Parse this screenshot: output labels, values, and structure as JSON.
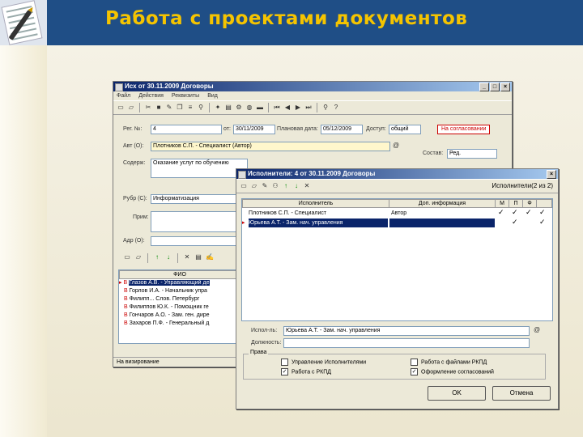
{
  "slide": {
    "title": "Работа с проектами документов"
  },
  "main_window": {
    "title": "Исх от 30.11.2009 Договоры",
    "menu": [
      "Файл",
      "Действия",
      "Реквизиты",
      "Вид"
    ],
    "reg_label": "Рег. №:",
    "reg_value": "4",
    "from_label": "от:",
    "from_value": "30/11/2009",
    "planned_label": "Плановая дата:",
    "planned_value": "05/12/2009",
    "access_label": "Доступ:",
    "access_value": "общий",
    "status_badge": "На согласовании",
    "author_label": "Авт (О):",
    "author_value": "Плотников С.П. - Специалист (Автор)",
    "content_label": "Содерж:",
    "content_value": "Оказание услуг по обучению",
    "state_label": "Состав:",
    "state_value": "Ред.",
    "rubric_label": "Рубр (С):",
    "rubric_value": "Информатизация",
    "note_label": "Прим:",
    "addr_label": "Адр (О):",
    "list_header": "ФИО",
    "list_rows": [
      {
        "mark": "В",
        "text": "Глазов А.В. - Управляющий де"
      },
      {
        "mark": "В",
        "text": "Горлов И.А. - Начальник упра"
      },
      {
        "mark": "В",
        "text": "Филипп... Слов. Петербург"
      },
      {
        "mark": "В",
        "text": "Филиппов Ю.К. - Помощник ге"
      },
      {
        "mark": "В",
        "text": "Гончаров А.О. - Зам. ген. дире"
      },
      {
        "mark": "В",
        "text": "Захаров П.Ф. - Генеральный д"
      }
    ],
    "statusbar": "На визирование"
  },
  "exec_window": {
    "title": "Исполнители: 4 от 30.11.2009 Договоры",
    "counter": "Исполнители(2 из 2)",
    "col_exec": "Исполнитель",
    "col_extra": "Доп. информация",
    "col_flags": [
      "М",
      "П",
      "Ф",
      ""
    ],
    "rows": [
      {
        "name": "Плотников С.П. - Специалист",
        "extra": "Автор",
        "flags": [
          "✓",
          "✓",
          "✓",
          "✓"
        ],
        "selected": false
      },
      {
        "name": "Юрьева А.Т. - Зам. нач. управления",
        "extra": "",
        "flags": [
          "",
          "✓",
          "",
          "✓"
        ],
        "selected": true
      }
    ],
    "person_label": "Испол-ль:",
    "person_value": "Юрьева А.Т. - Зам. нач. управления",
    "position_label": "Должность:",
    "rights_label": "Права",
    "rights": [
      {
        "label": "Управление Исполнителями",
        "checked": false
      },
      {
        "label": "Работа с файлами РКПД",
        "checked": false
      },
      {
        "label": "Работа с РКПД",
        "checked": true
      },
      {
        "label": "Оформление согласований",
        "checked": true
      }
    ],
    "ok_label": "OK",
    "cancel_label": "Отмена"
  }
}
